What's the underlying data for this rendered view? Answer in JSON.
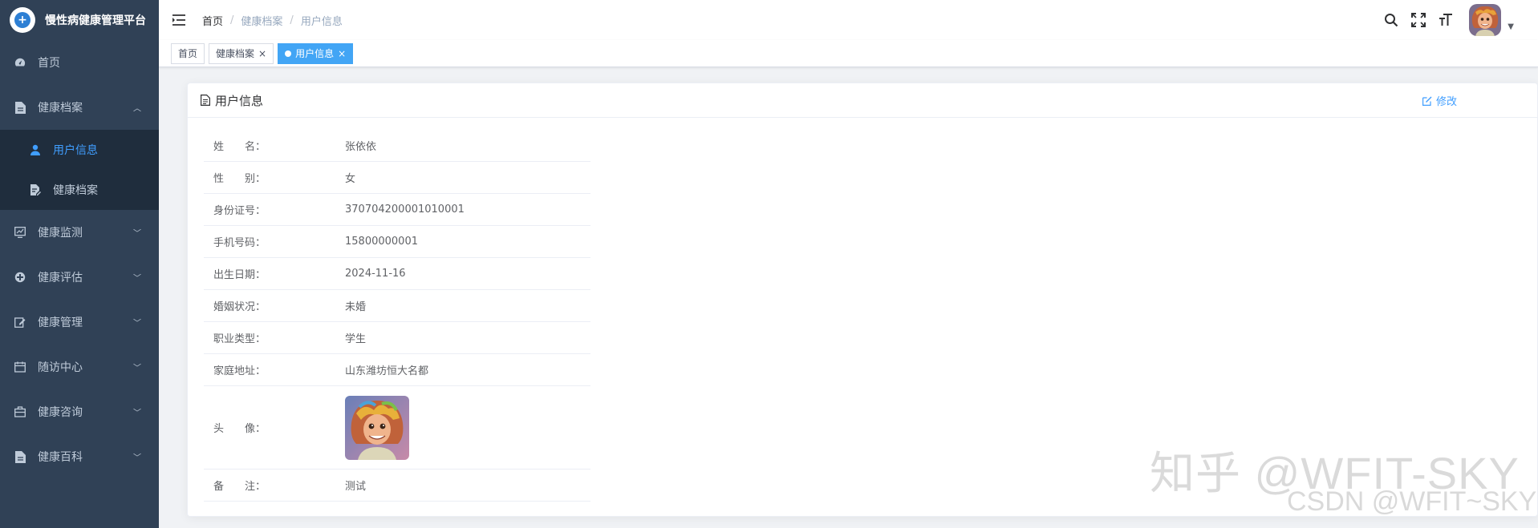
{
  "app": {
    "title": "慢性病健康管理平台"
  },
  "sidebar": {
    "items": [
      {
        "label": "首页",
        "icon": "dashboard-icon"
      },
      {
        "label": "健康档案",
        "icon": "document-icon",
        "expanded": true,
        "children": [
          {
            "label": "用户信息",
            "icon": "user-icon",
            "active": true
          },
          {
            "label": "健康档案",
            "icon": "file-edit-icon"
          }
        ]
      },
      {
        "label": "健康监测",
        "icon": "monitor-chart-icon"
      },
      {
        "label": "健康评估",
        "icon": "assessment-icon"
      },
      {
        "label": "健康管理",
        "icon": "manage-icon"
      },
      {
        "label": "随访中心",
        "icon": "calendar-icon"
      },
      {
        "label": "健康咨询",
        "icon": "briefcase-icon"
      },
      {
        "label": "健康百科",
        "icon": "encyclopedia-icon"
      }
    ]
  },
  "breadcrumb": [
    "首页",
    "健康档案",
    "用户信息"
  ],
  "tags": [
    {
      "label": "首页",
      "closable": false,
      "active": false
    },
    {
      "label": "健康档案",
      "closable": true,
      "active": false
    },
    {
      "label": "用户信息",
      "closable": true,
      "active": true
    }
  ],
  "card": {
    "title": "用户信息",
    "edit_label": "修改",
    "fields": [
      {
        "label": "姓　　名：",
        "value": "张依依"
      },
      {
        "label": "性　　别：",
        "value": "女"
      },
      {
        "label": "身份证号：",
        "value": "370704200001010001"
      },
      {
        "label": "手机号码：",
        "value": "15800000001"
      },
      {
        "label": "出生日期：",
        "value": "2024-11-16"
      },
      {
        "label": "婚姻状况：",
        "value": "未婚"
      },
      {
        "label": "职业类型：",
        "value": "学生"
      },
      {
        "label": "家庭地址：",
        "value": "山东潍坊恒大名都"
      },
      {
        "label": "头　　像：",
        "value": ""
      },
      {
        "label": "备　　注：",
        "value": "测试"
      }
    ]
  },
  "watermark": {
    "line1": "知乎 @WFIT-SKY",
    "line2": "CSDN @WFIT~SKY"
  },
  "colors": {
    "sidebar_bg": "#304156",
    "submenu_bg": "#1f2d3d",
    "accent": "#409eff",
    "active_tag": "#42a5f5"
  }
}
